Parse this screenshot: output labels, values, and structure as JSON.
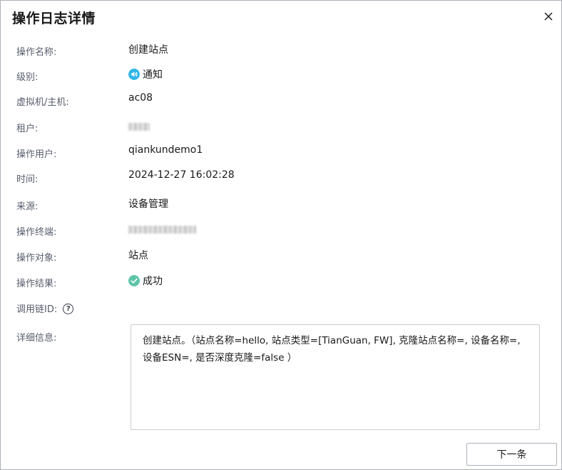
{
  "dialog": {
    "title": "操作日志详情",
    "close_icon": "close-icon",
    "next_button_label": "下一条"
  },
  "fields": {
    "op_name": {
      "label": "操作名称:",
      "value": "创建站点"
    },
    "level": {
      "label": "级别:",
      "value": "通知",
      "icon": "sound-info-icon",
      "icon_color": "#2fb5e8"
    },
    "host": {
      "label": "虚拟机/主机:",
      "value": "ac08"
    },
    "tenant": {
      "label": "租户:"
    },
    "user": {
      "label": "操作用户:",
      "value": "qiankundemo1"
    },
    "time": {
      "label": "时间:",
      "value": "2024-12-27 16:02:28"
    },
    "source": {
      "label": "来源:",
      "value": "设备管理"
    },
    "terminal": {
      "label": "操作终端:"
    },
    "target": {
      "label": "操作对象:",
      "value": "站点"
    },
    "result": {
      "label": "操作结果:",
      "value": "成功",
      "icon": "check-circle-icon",
      "icon_color": "#5ec4a8"
    },
    "trace_id": {
      "label": "调用链ID:",
      "help_icon": "question-circle-icon"
    },
    "detail": {
      "label": "详细信息:",
      "value": "创建站点。（站点名称=hello, 站点类型=[TianGuan, FW], 克隆站点名称=, 设备名称=, 设备ESN=, 是否深度克隆=false ）"
    }
  }
}
